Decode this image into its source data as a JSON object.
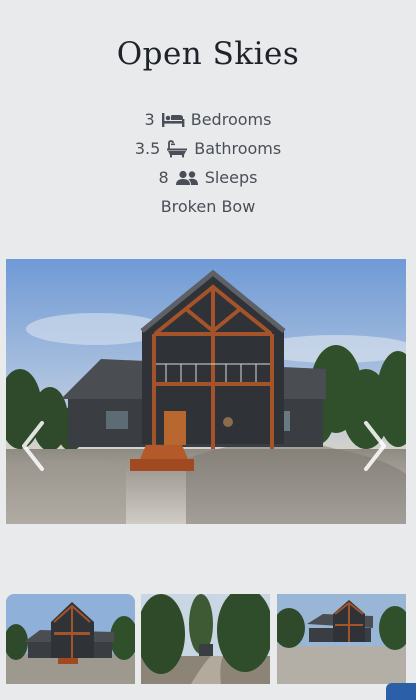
{
  "listing": {
    "title": "Open Skies",
    "bedrooms": {
      "count": "3",
      "label": "Bedrooms",
      "icon": "bed-icon"
    },
    "bathrooms": {
      "count": "3.5",
      "label": "Bathrooms",
      "icon": "bathtub-icon"
    },
    "sleeps": {
      "count": "8",
      "label": "Sleeps",
      "icon": "people-icon"
    },
    "location": "Broken Bow"
  },
  "gallery": {
    "thumbnail_count": 3
  },
  "colors": {
    "background": "#e9eaec",
    "text": "#2b2f36",
    "badge": "#2b5fa8"
  }
}
